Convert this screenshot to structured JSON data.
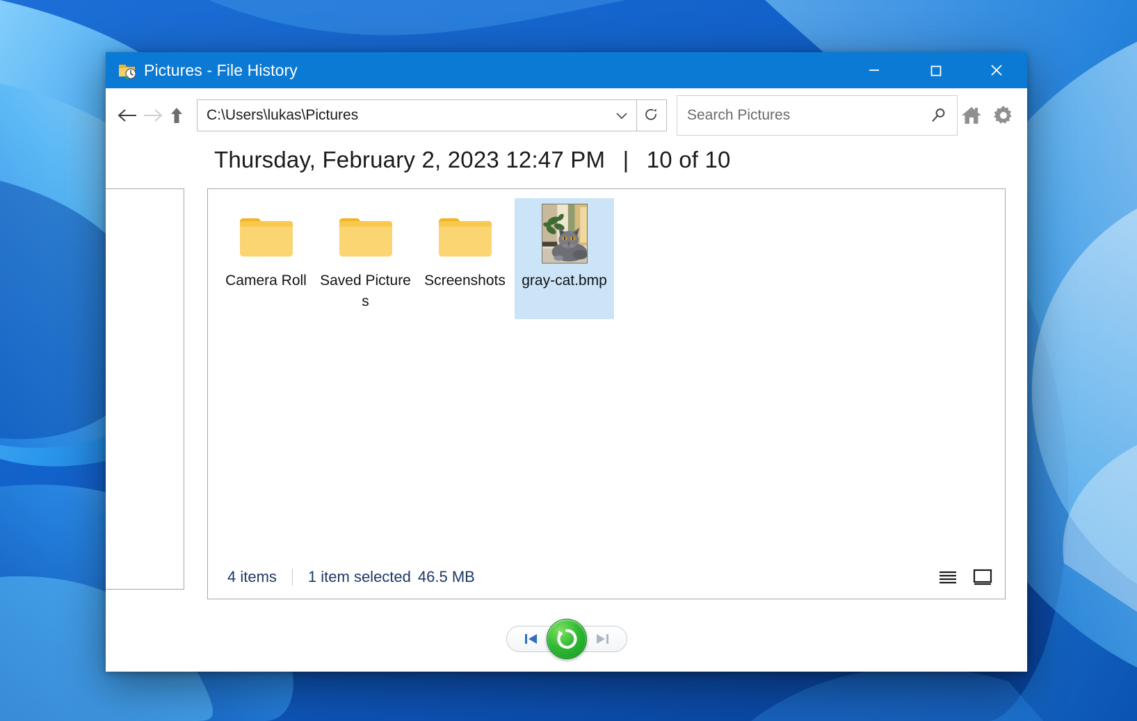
{
  "window": {
    "title": "Pictures - File History",
    "title_icon": "folder-history-icon",
    "controls": {
      "minimize": "minimize-icon",
      "maximize": "maximize-icon",
      "close": "close-icon"
    }
  },
  "toolbar": {
    "back": "back-arrow-icon",
    "forward": "forward-arrow-icon",
    "up": "up-arrow-icon",
    "address_value": "C:\\Users\\lukas\\Pictures",
    "address_chevron": "chevron-down-icon",
    "refresh": "refresh-icon",
    "search_placeholder": "Search Pictures",
    "search_value": "",
    "search_icon": "search-icon",
    "home": "home-icon",
    "settings": "gear-icon"
  },
  "header": {
    "datetime": "Thursday, February 2, 2023 12:47 PM",
    "separator": "|",
    "counter": "10 of 10"
  },
  "items": [
    {
      "name": "Camera Roll",
      "type": "folder",
      "selected": false
    },
    {
      "name": "Saved Pictures",
      "type": "folder",
      "selected": false
    },
    {
      "name": "Screenshots",
      "type": "folder",
      "selected": false
    },
    {
      "name": "gray-cat.bmp",
      "type": "image",
      "selected": true
    }
  ],
  "status": {
    "item_count": "4 items",
    "selection": "1 item selected",
    "size": "46.5 MB",
    "view_details": "details-view-icon",
    "view_large_icons": "large-icons-view-icon"
  },
  "bottom": {
    "previous_label": "previous-version-icon",
    "restore_label": "restore-icon",
    "next_label": "next-version-icon",
    "next_disabled": true
  },
  "colors": {
    "titlebar": "#0b7ad4",
    "selection": "#cce4f7",
    "folder": "#fbd46d",
    "folder_tab": "#f5b924",
    "restore_green": "#2bb32f",
    "status_text": "#1f3864",
    "nav_enabled": "#2f6fbd",
    "nav_disabled": "#a9b7c6"
  }
}
